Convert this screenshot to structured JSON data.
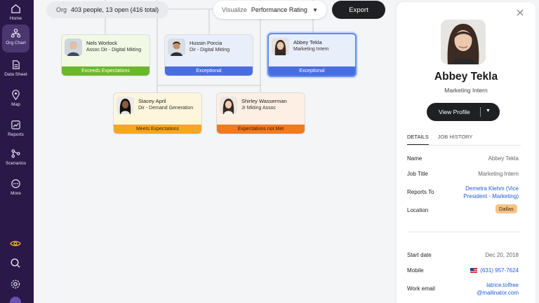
{
  "nav": {
    "items": [
      {
        "label": "Home",
        "icon": "home-icon"
      },
      {
        "label": "Org Chart",
        "icon": "org-chart-icon"
      },
      {
        "label": "Data Sheet",
        "icon": "data-sheet-icon"
      },
      {
        "label": "Map",
        "icon": "map-pin-icon"
      },
      {
        "label": "Reports",
        "icon": "reports-icon"
      },
      {
        "label": "Scenarios",
        "icon": "scenarios-icon"
      },
      {
        "label": "More",
        "icon": "more-icon"
      }
    ],
    "active": "Org Chart",
    "bottom_icons": [
      "eye-icon",
      "search-icon",
      "settings-icon"
    ]
  },
  "toolbar": {
    "org_label": "Org",
    "org_value": "403 people, 13 open (416 total)",
    "visualize_label": "Visualize",
    "visualize_value": "Performance Rating",
    "export_label": "Export"
  },
  "cards": [
    {
      "name": "Nels Worlock",
      "title": "Assoc Dir - Digital Mkting",
      "rating": "Exceeds Expectations",
      "card_bg": "#f1f8e3",
      "band_bg": "#6bb82a",
      "band_fg": "#ffffff"
    },
    {
      "name": "Hussin Porcia",
      "title": "Dir - Digital Mkting",
      "rating": "Exceptional",
      "card_bg": "#e9eefb",
      "band_bg": "#4a6ee0",
      "band_fg": "#ffffff"
    },
    {
      "name": "Abbey Tekla",
      "title": "Marketing Intern",
      "rating": "Exceptional",
      "card_bg": "#e9eefb",
      "band_bg": "#4a6ee0",
      "band_fg": "#ffffff"
    },
    {
      "name": "Stacey April",
      "title": "Dir - Demand Generation",
      "rating": "Meets Expectations",
      "card_bg": "#fdf6dc",
      "band_bg": "#f5a623",
      "band_fg": "#3a2a00"
    },
    {
      "name": "Shirley Wasserman",
      "title": "Jr Mkting Assoc",
      "rating": "Expectations not Met",
      "card_bg": "#fdefe3",
      "band_bg": "#f07a22",
      "band_fg": "#3a1a00"
    }
  ],
  "panel": {
    "name": "Abbey Tekla",
    "title": "Marketing Intern",
    "view_profile": "View Profile",
    "tabs": [
      "DETAILS",
      "JOB HISTORY"
    ],
    "details": {
      "name_label": "Name",
      "name_value": "Abbey Tekla",
      "job_label": "Job Title",
      "job_value": "Marketing Intern",
      "reports_label": "Reports To",
      "reports_line1": "Demetra Klehm (Vice",
      "reports_line2": "President - Marketing)",
      "location_label": "Location",
      "location_value": "Dallas",
      "start_label": "Start date",
      "start_value": "Dec 20, 2018",
      "mobile_label": "Mobile",
      "mobile_value": "(631) 957-7624",
      "email_label": "Work email",
      "email_line1": "latrice.tolfree",
      "email_line2": "@mailinator.com"
    }
  }
}
